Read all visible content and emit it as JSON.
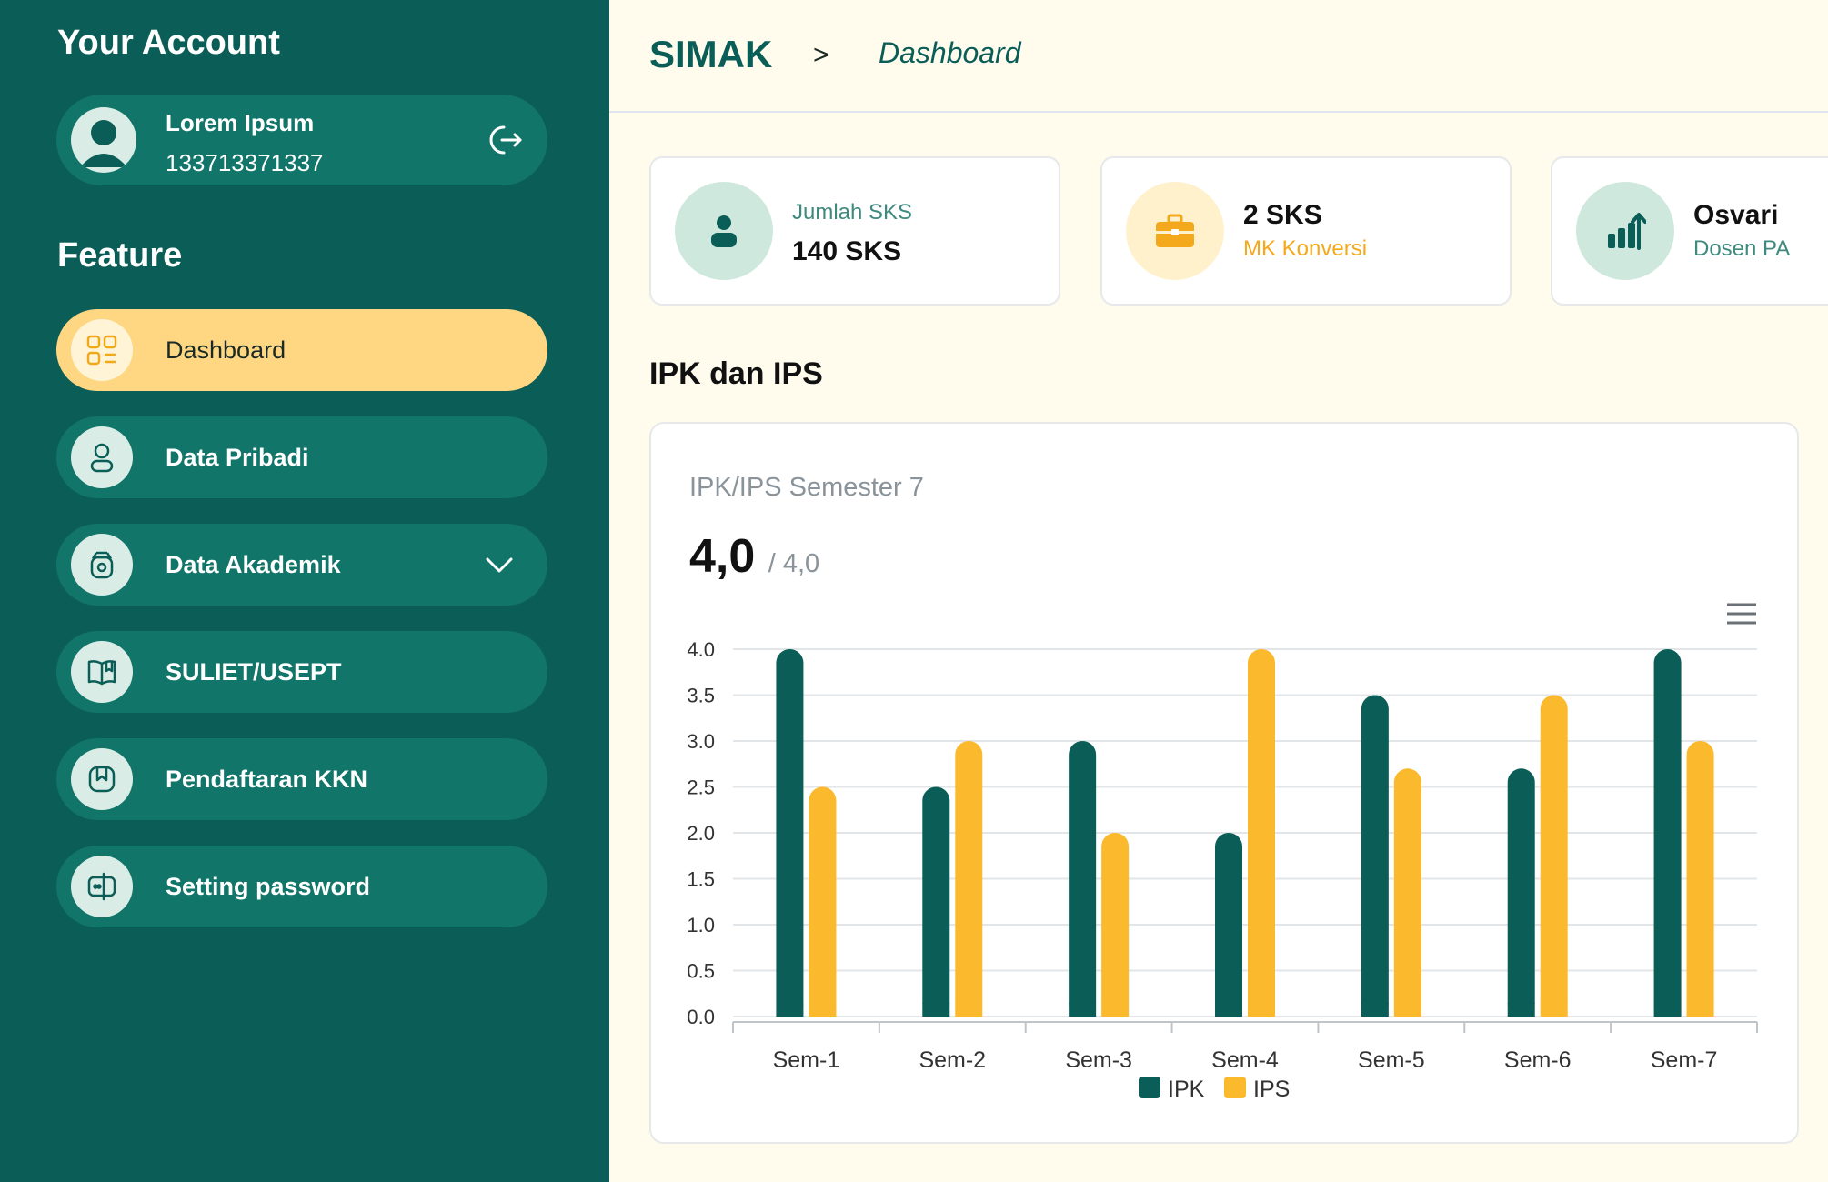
{
  "sidebar": {
    "account_heading": "Your Account",
    "user": {
      "name": "Lorem Ipsum",
      "id": "133713371337"
    },
    "feature_heading": "Feature",
    "items": [
      {
        "label": "Dashboard",
        "icon": "dashboard-icon",
        "active": true
      },
      {
        "label": "Data Pribadi",
        "icon": "person-icon"
      },
      {
        "label": "Data Akademik",
        "icon": "academic-icon"
      },
      {
        "label": "SULIET/USEPT",
        "icon": "book-icon"
      },
      {
        "label": "Pendaftaran KKN",
        "icon": "bookmark-icon"
      },
      {
        "label": "Setting password",
        "icon": "password-icon"
      }
    ]
  },
  "header": {
    "brand": "SIMAK",
    "separator": ">",
    "page": "Dashboard"
  },
  "stats": [
    {
      "top": "Jumlah SKS",
      "bottom": "140 SKS",
      "icon": "user-icon"
    },
    {
      "top": "2 SKS",
      "bottom": "MK Konversi",
      "icon": "briefcase-icon"
    },
    {
      "top": "Osvari",
      "bottom": "Dosen PA",
      "icon": "chart-up-icon"
    }
  ],
  "section_title": "IPK dan IPS",
  "chart_card": {
    "title": "IPK/IPS Semester 7",
    "value": "4,0",
    "max": "/ 4,0"
  },
  "colors": {
    "primary": "#0b5e57",
    "accent": "#fbb92d",
    "active_nav": "#ffd783"
  },
  "chart_data": {
    "type": "bar",
    "categories": [
      "Sem-1",
      "Sem-2",
      "Sem-3",
      "Sem-4",
      "Sem-5",
      "Sem-6",
      "Sem-7"
    ],
    "series": [
      {
        "name": "IPK",
        "values": [
          4.0,
          2.5,
          3.0,
          2.0,
          3.5,
          2.7,
          4.0
        ],
        "color": "#0b5e57"
      },
      {
        "name": "IPS",
        "values": [
          2.5,
          3.0,
          2.0,
          4.0,
          2.7,
          3.5,
          3.0
        ],
        "color": "#fbb92d"
      }
    ],
    "yticks": [
      "0.0",
      "0.5",
      "1.0",
      "1.5",
      "2.0",
      "2.5",
      "3.0",
      "3.5",
      "4.0"
    ],
    "ylim": [
      0,
      4
    ],
    "grid": true,
    "legend": "bottom"
  }
}
